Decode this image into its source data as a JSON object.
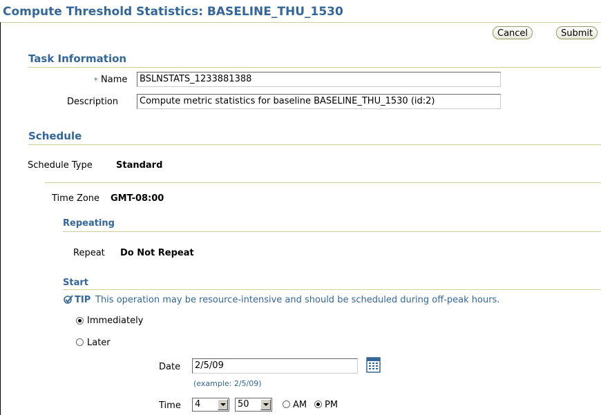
{
  "page": {
    "title": "Compute Threshold Statistics: BASELINE_THU_1530"
  },
  "buttons": {
    "cancel": "Cancel",
    "submit": "Submit"
  },
  "task_information": {
    "heading": "Task Information",
    "required_mark": "*",
    "name_label": "Name",
    "name_value": "BSLNSTATS_1233881388",
    "description_label": "Description",
    "description_value": "Compute metric statistics for baseline BASELINE_THU_1530 (id:2)"
  },
  "schedule": {
    "heading": "Schedule",
    "type_label": "Schedule Type",
    "type_value": "Standard",
    "timezone_label": "Time Zone",
    "timezone_value": "GMT-08:00",
    "repeating": {
      "heading": "Repeating",
      "repeat_label": "Repeat",
      "repeat_value": "Do Not Repeat"
    },
    "start": {
      "heading": "Start",
      "tip_label": "TIP",
      "tip_text": "This operation may be resource-intensive and should be scheduled during off-peak hours.",
      "immediately_label": "Immediately",
      "later_label": "Later",
      "selected": "Immediately",
      "date_label": "Date",
      "date_value": "2/5/09",
      "date_example": "(example: 2/5/09)",
      "time_label": "Time",
      "hour_value": "4",
      "minute_value": "50",
      "am_label": "AM",
      "pm_label": "PM",
      "ampm_selected": "PM"
    }
  },
  "icons": {
    "tip": "check-circle-icon",
    "calendar": "calendar-icon"
  },
  "colors": {
    "heading": "#336699",
    "rule": "#cccc99"
  }
}
